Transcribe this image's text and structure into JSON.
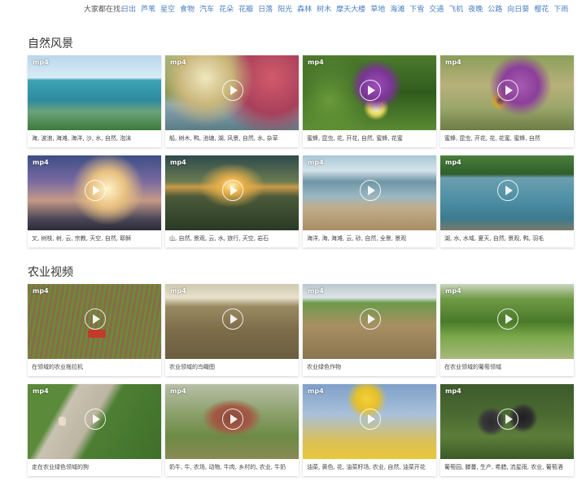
{
  "tagbar": {
    "lead": "大家都在找:",
    "tags": [
      "日出",
      "芦苇",
      "星空",
      "食物",
      "汽车",
      "花朵",
      "花瓣",
      "日落",
      "阳光",
      "森林",
      "树木",
      "摩天大楼",
      "草地",
      "海滩",
      "下雪",
      "交通",
      "飞机",
      "夜晚",
      "公路",
      "向日葵",
      "樱花",
      "下雨"
    ]
  },
  "sections": [
    {
      "title": "自然风景",
      "cards": [
        {
          "badge": "mp4",
          "caption": "海, 波浪, 海滩, 海洋, 沙, 水, 自然, 泡沫"
        },
        {
          "badge": "mp4",
          "caption": "船, 树木, 鸭, 池塘, 湖, 风景, 自然, 水, 杂草"
        },
        {
          "badge": "mp4",
          "caption": "蜜蜂, 昆虫, 花, 开花, 自然, 蜜蜂, 花蜜"
        },
        {
          "badge": "mp4",
          "caption": "蜜蜂, 昆虫, 开花, 花, 花蜜, 蜜蜂, 自然"
        },
        {
          "badge": "mp4",
          "caption": "叉, 树枝, 树, 云, 宗教, 天空, 自然, 耶稣"
        },
        {
          "badge": "mp4",
          "caption": "山, 自然, 景观, 云, 水, 旅行, 天空, 岩石"
        },
        {
          "badge": "mp4",
          "caption": "海洋, 海, 海滩, 云, 砂, 自然, 全景, 景观"
        },
        {
          "badge": "mp4",
          "caption": "湖, 水, 水域, 夏天, 自然, 景观, 鸭, 羽毛"
        }
      ]
    },
    {
      "title": "农业视频",
      "cards": [
        {
          "badge": "mp4",
          "caption": "在领域的农业拖拉机"
        },
        {
          "badge": "mp4",
          "caption": "农业领域的鸟瞰图"
        },
        {
          "badge": "mp4",
          "caption": "农业绿色作物"
        },
        {
          "badge": "mp4",
          "caption": "在农业领域的葡萄领域"
        },
        {
          "badge": "mp4",
          "caption": "走在农业绿色领域的狗"
        },
        {
          "badge": "mp4",
          "caption": "奶牛, 牛, 农场, 动物, 牛肉, 乡村的, 农业, 牛奶"
        },
        {
          "badge": "mp4",
          "caption": "油菜, 黄色, 花, 油菜籽场, 农业, 自然, 油菜开花"
        },
        {
          "badge": "mp4",
          "caption": "葡萄园, 滕蔓, 生产, 希腊, 流星雨, 农业, 葡萄酒"
        }
      ]
    }
  ]
}
